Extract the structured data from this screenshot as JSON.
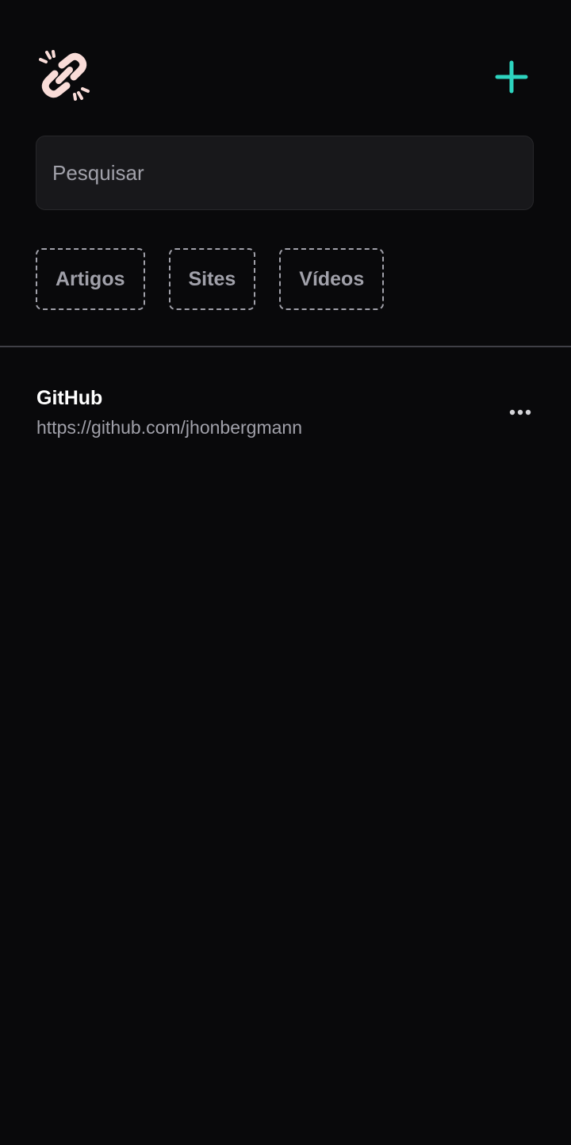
{
  "header": {
    "logo_icon": "broken-link-icon",
    "add_icon": "plus-icon",
    "logo_color": "#f9dcd8",
    "accent_color": "#2dd4bf"
  },
  "search": {
    "placeholder": "Pesquisar",
    "value": ""
  },
  "filters": [
    "Artigos",
    "Sites",
    "Vídeos"
  ],
  "links": [
    {
      "title": "GitHub",
      "url": "https://github.com/jhonbergmann",
      "menu_icon": "more-horizontal-icon"
    }
  ]
}
